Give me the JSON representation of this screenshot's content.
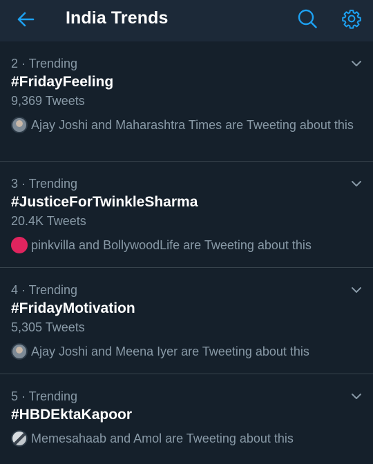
{
  "header": {
    "title": "India Trends",
    "back_icon": "arrow-left-icon",
    "search_icon": "search-icon",
    "settings_icon": "gear-icon"
  },
  "colors": {
    "accent": "#1da1f2",
    "background": "#15202b",
    "header_bg": "#1c2938",
    "secondary_text": "#8899a6",
    "divider": "#38444d"
  },
  "trends": [
    {
      "meta": "2 · Trending",
      "name": "#FridayFeeling",
      "count": "9,369 Tweets",
      "tweeters": "Ajay Joshi and Maharashtra Times are Tweeting about this",
      "avatar_color": "#8a9096"
    },
    {
      "meta": "3 · Trending",
      "name": "#JusticeForTwinkleSharma",
      "count": "20.4K Tweets",
      "tweeters": "pinkvilla and BollywoodLife are Tweeting about this",
      "avatar_color": "#e0245e"
    },
    {
      "meta": "4 · Trending",
      "name": "#FridayMotivation",
      "count": "5,305 Tweets",
      "tweeters": "Ajay Joshi and Meena Iyer are Tweeting about this",
      "avatar_color": "#8a9096"
    },
    {
      "meta": "5 · Trending",
      "name": "#HBDEktaKapoor",
      "count": "",
      "tweeters": "Memesahaab and Amol are Tweeting about this",
      "avatar_color": "#6e7479"
    }
  ]
}
